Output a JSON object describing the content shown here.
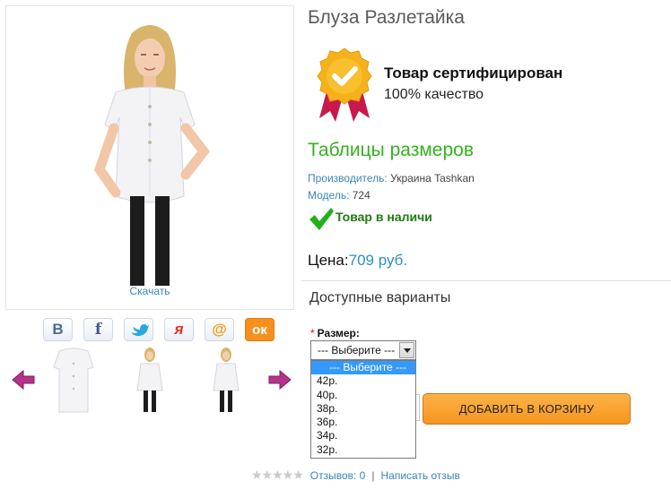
{
  "product": {
    "title": "Блуза Разлетайка",
    "download_label": "Скачать"
  },
  "certificate": {
    "title": "Товар сертифицирован",
    "subtitle": "100% качество",
    "icon": "certified-badge-icon"
  },
  "size_tables_label": "Таблицы размеров",
  "manufacturer": {
    "label": "Производитель:",
    "value": "Украина Tashkan"
  },
  "model": {
    "label": "Модель:",
    "value": "724"
  },
  "stock_status": "Товар в наличи",
  "price": {
    "label": "Цена:",
    "value": "709 руб."
  },
  "variants_heading": "Доступные варианты",
  "size_option": {
    "required_mark": "*",
    "label": "Размер:",
    "selected": "--- Выберите ---",
    "options": [
      "--- Выберите ---",
      "42р.",
      "40р.",
      "38р.",
      "36р.",
      "34р.",
      "32р."
    ]
  },
  "add_to_cart_label": "ДОБАВИТЬ В КОРЗИНУ",
  "social": [
    {
      "name": "vk",
      "glyph": "B"
    },
    {
      "name": "facebook",
      "glyph": "f"
    },
    {
      "name": "twitter",
      "glyph": "🐦"
    },
    {
      "name": "yandex",
      "glyph": "я"
    },
    {
      "name": "mail",
      "glyph": "@"
    },
    {
      "name": "odnoklassniki",
      "glyph": "ок"
    }
  ],
  "reviews": {
    "stars": "★★★★★",
    "rating": 0,
    "reviews_label": "Отзывов: 0",
    "separator": "|",
    "write_review_label": "Написать отзыв"
  },
  "colors": {
    "link": "#3a87b8",
    "green_title": "#34b11f",
    "price": "#2a8fc6",
    "button": "#f5951f",
    "arrow": "#b5338a"
  }
}
